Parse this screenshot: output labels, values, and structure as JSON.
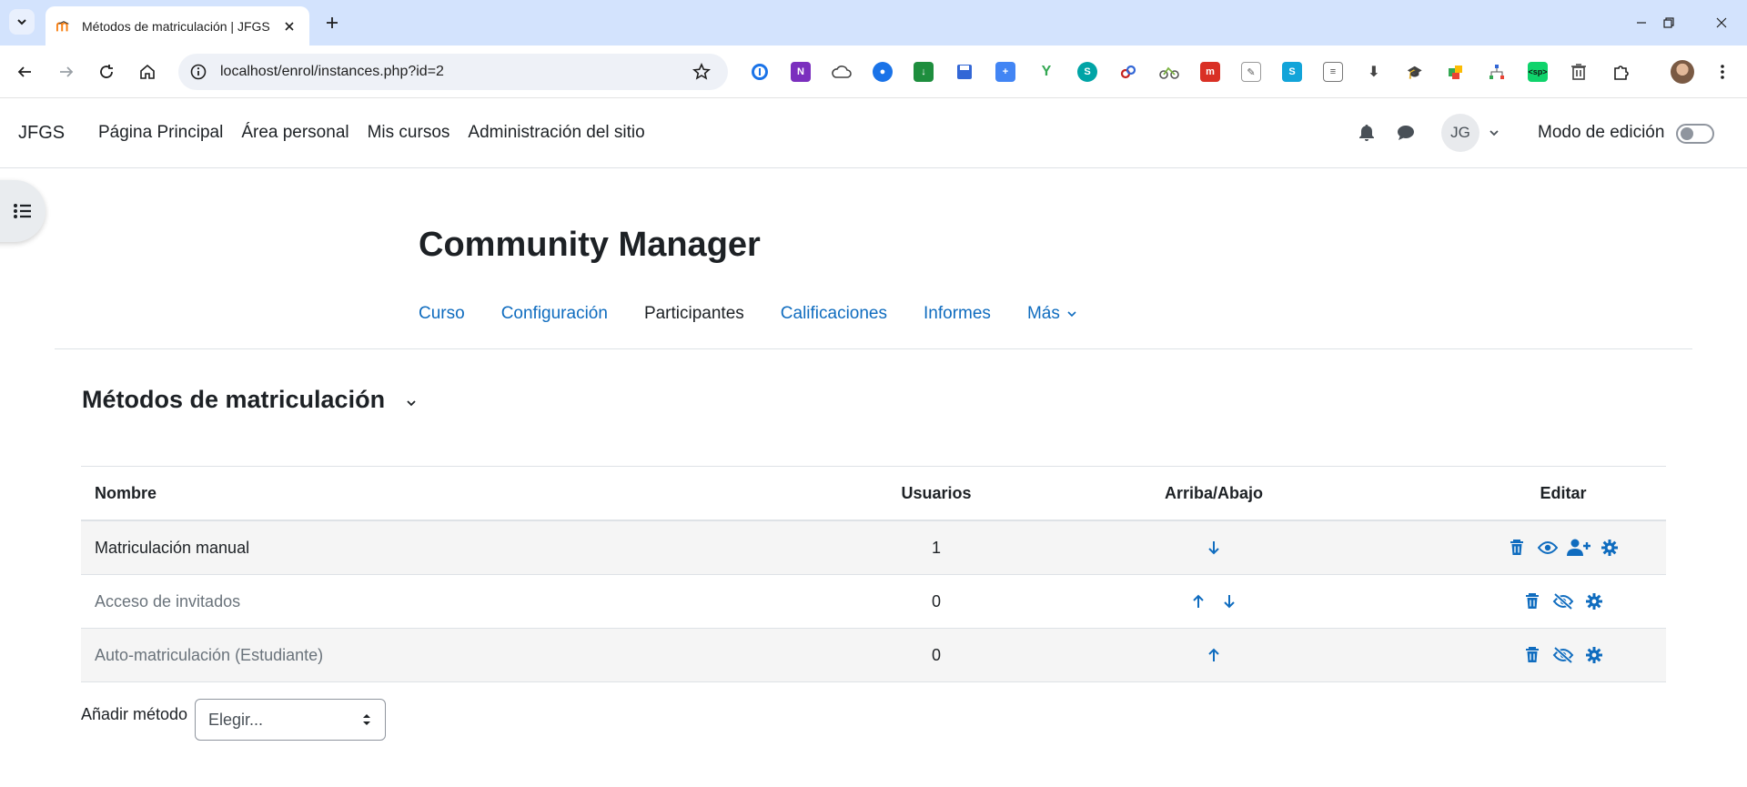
{
  "browser": {
    "tab_title": "Métodos de matriculación | JFGS",
    "url": "localhost/enrol/instances.php?id=2"
  },
  "navbar": {
    "brand": "JFGS",
    "items": [
      "Página Principal",
      "Área personal",
      "Mis cursos",
      "Administración del sitio"
    ],
    "avatar_initials": "JG",
    "edit_mode_label": "Modo de edición"
  },
  "course": {
    "title": "Community Manager",
    "secondary_nav": [
      "Curso",
      "Configuración",
      "Participantes",
      "Calificaciones",
      "Informes",
      "Más"
    ],
    "active_tab": "Participantes"
  },
  "page": {
    "section_title": "Métodos de matriculación"
  },
  "table": {
    "headers": {
      "name": "Nombre",
      "users": "Usuarios",
      "updown": "Arriba/Abajo",
      "edit": "Editar"
    },
    "rows": [
      {
        "name": "Matriculación manual",
        "users": "1",
        "up": false,
        "down": true,
        "hidden": false,
        "enrol_users": true
      },
      {
        "name": "Acceso de invitados",
        "users": "0",
        "up": true,
        "down": true,
        "hidden": true,
        "enrol_users": false
      },
      {
        "name": "Auto-matriculación (Estudiante)",
        "users": "0",
        "up": true,
        "down": false,
        "hidden": true,
        "enrol_users": false
      }
    ]
  },
  "add_method": {
    "label": "Añadir método",
    "select_value": "Elegir..."
  },
  "colors": {
    "accent": "#0f6cbf",
    "text": "#1d2125",
    "dimmed": "#6a737b",
    "chrome_bg": "#d3e3fd"
  }
}
